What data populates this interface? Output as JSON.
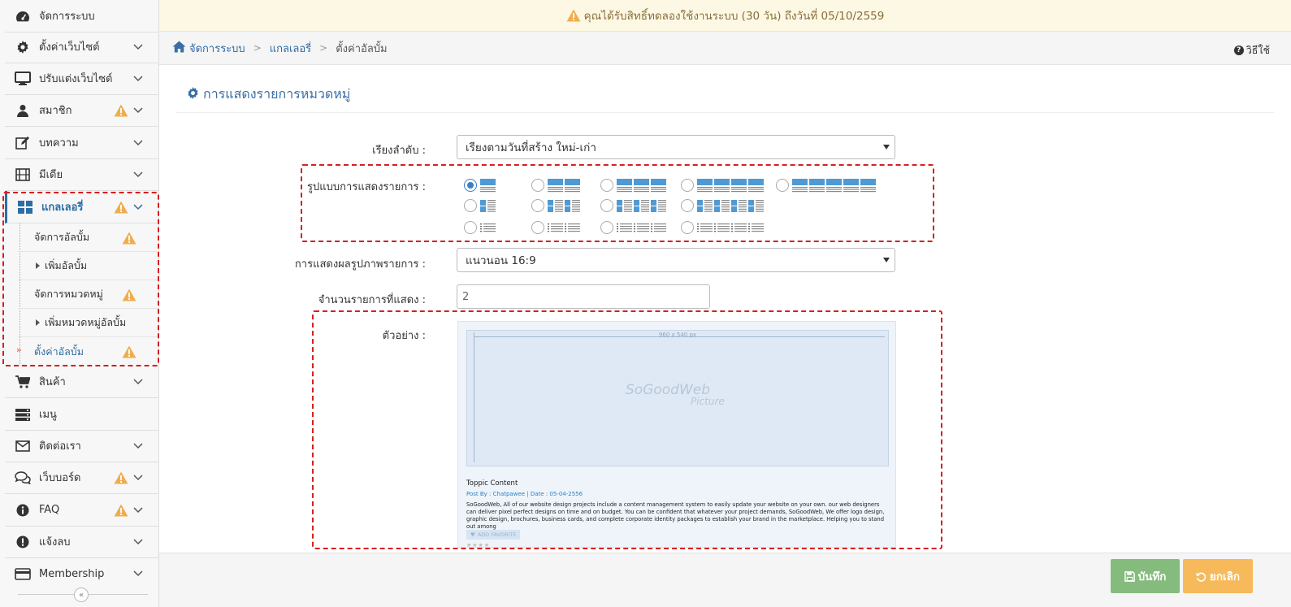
{
  "banner": {
    "text": "คุณได้รับสิทธิ์ทดลองใช้งานระบบ (30 วัน) ถึงวันที่ 05/10/2559"
  },
  "breadcrumb": {
    "home": "จัดการระบบ",
    "level2": "แกลเลอรี่",
    "current": "ตั้งค่าอัลบั้ม"
  },
  "help": {
    "label": "วิธีใช้"
  },
  "sidebar": {
    "items": [
      {
        "label": "จัดการระบบ",
        "icon": "dashboard-icon"
      },
      {
        "label": "ตั้งค่าเว็บไซต์",
        "icon": "gear-icon"
      },
      {
        "label": "ปรับแต่งเว็บไซต์",
        "icon": "monitor-icon"
      },
      {
        "label": "สมาชิก",
        "icon": "user-icon"
      },
      {
        "label": "บทความ",
        "icon": "edit-icon"
      },
      {
        "label": "มีเดีย",
        "icon": "film-icon"
      },
      {
        "label": "แกลเลอรี่",
        "icon": "grid-icon"
      },
      {
        "label": "สินค้า",
        "icon": "cart-icon"
      },
      {
        "label": "เมนู",
        "icon": "list-icon"
      },
      {
        "label": "ติดต่อเรา",
        "icon": "envelope-icon"
      },
      {
        "label": "เว็บบอร์ด",
        "icon": "comments-icon"
      },
      {
        "label": "FAQ",
        "icon": "info-icon"
      },
      {
        "label": "แจ้งลบ",
        "icon": "exclamation-icon"
      },
      {
        "label": "Membership",
        "icon": "credit-card-icon"
      }
    ],
    "gallery_sub": [
      {
        "label": "จัดการอัลบั้ม"
      },
      {
        "label": "เพิ่มอัลบั้ม"
      },
      {
        "label": "จัดการหมวดหมู่"
      },
      {
        "label": "เพิ่มหมวดหมู่อัลบั้ม"
      },
      {
        "label": "ตั้งค่าอัลบั้ม"
      }
    ],
    "collapse_glyph": "«"
  },
  "section": {
    "title": "การแสดงรายการหมวดหมู่"
  },
  "form": {
    "sort_label": "เรียงลำดับ :",
    "sort_value": "เรียงตามวันที่สร้าง ใหม่-เก่า",
    "layout_label": "รูปแบบการแสดงรายการ :",
    "layout_selected": 1,
    "image_label": "การแสดงผลรูปภาพรายการ :",
    "image_value": "แนวนอน 16:9",
    "count_label": "จำนวนรายการที่แสดง :",
    "count_value": "2",
    "preview_label": "ตัวอย่าง :"
  },
  "preview": {
    "dims": "960 x 540 px",
    "watermark1": "SoGoodWeb",
    "watermark2": "Picture",
    "title": "Toppic Content",
    "meta": "Post By : Chatpawee  |  Date : 05-04-2556",
    "body": "SoGoodWeb, All of our website design projects include a content management system to easily update your website on your own. our web designers can deliver pixel perfect designs on time and on budget. You can be confident that whatever your project demands, SoGoodWeb, We offer logo design, graphic design, brochures, business cards, and complete corporate identity packages to establish your brand in the marketplace. Helping you to stand out among",
    "fav": "ADD FAVORITE",
    "stars": "★★★★"
  },
  "footer": {
    "save_label": "บันทึก",
    "cancel_label": "ยกเลิก"
  },
  "colors": {
    "accent": "#2e6da4",
    "warning": "#f0ad4e",
    "dashed": "#d62020",
    "save": "#86bb7e",
    "cancel": "#f6ba5a"
  }
}
